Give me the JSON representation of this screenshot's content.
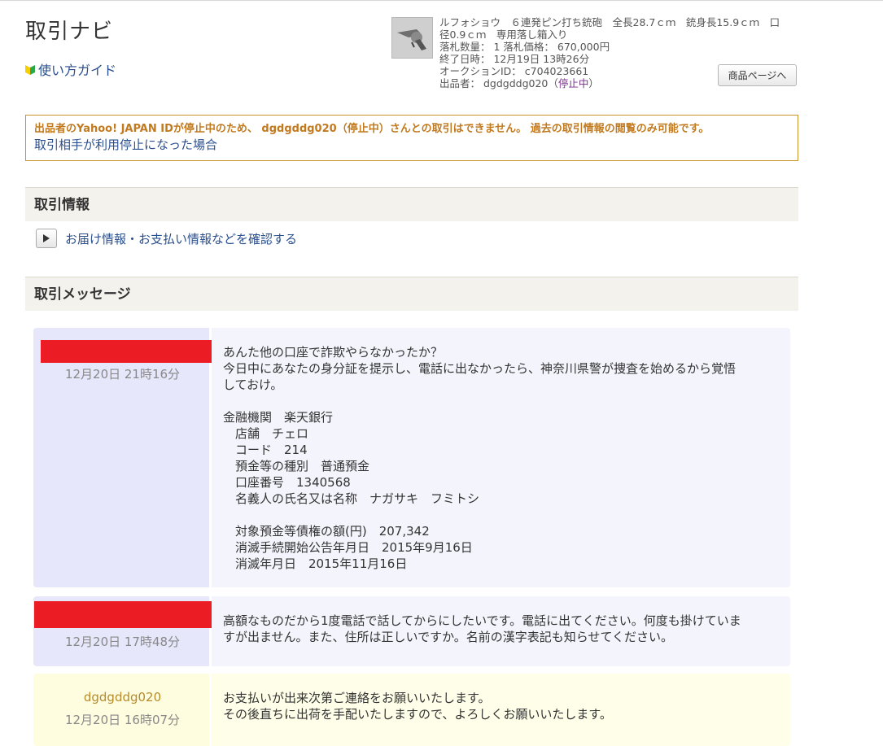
{
  "header": {
    "title": "取引ナビ",
    "guide_link": "使い方ガイド"
  },
  "item": {
    "line1": "ルフォショウ　６連発ピン打ち銃砲　全長28.7ｃｍ　銃身長15.9ｃｍ　口",
    "line2": "径0.9ｃｍ　専用落し箱入り",
    "line3": "落札数量：  1  落札価格：  670,000円",
    "line4": "終了日時：  12月19日 13時26分",
    "line5": "オークションID：  c704023661",
    "seller_prefix": "出品者：  dgdgddg020（",
    "seller_status": "停止中",
    "seller_suffix": "）",
    "page_button": "商品ページへ"
  },
  "notice": {
    "warning": "出品者のYahoo! JAPAN IDが停止中のため、 dgdgddg020（停止中）さんとの取引はできません。 過去の取引情報の閲覧のみ可能です。",
    "link": "取引相手が利用停止になった場合"
  },
  "trade_info": {
    "heading": "取引情報",
    "link": "お届け情報・お支払い情報などを確認する"
  },
  "messages": {
    "heading": "取引メッセージ",
    "items": [
      {
        "timestamp": "12月20日 21時16分",
        "text": "あんた他の口座で詐欺やらなかったか？\n今日中にあなたの身分証を提示し、電話に出なかったら、神奈川県警が捜査を始めるから覚悟\nしておけ。\n\n金融機関　楽天銀行\n　店舗　チェロ\n　コード　214\n　預金等の種別　普通預金\n　口座番号　1340568\n　名義人の氏名又は名称　ナガサキ　フミトシ\n\n　対象預金等債権の額(円)　207,342\n　消滅手続開始公告年月日　2015年9月16日\n　消滅年月日　2015年11月16日"
      },
      {
        "timestamp": "12月20日 17時48分",
        "text": "高額なものだから1度電話で話してからにしたいです。電話に出てください。何度も掛けていま\nすが出ません。また、住所は正しいですか。名前の漢字表記も知らせてください。"
      },
      {
        "sender": "dgdgddg020",
        "timestamp": "12月20日 16時07分",
        "text": "お支払いが出来次第ご連絡をお願いいたします。\nその後直ちに出荷を手配いたしますので、よろしくお願いいたします。"
      }
    ]
  },
  "colors": {
    "link": "#2a4f8f",
    "warning": "#c27a1f",
    "redaction": "#ec1c24",
    "buyer_side": "#e6e7fb",
    "seller_side": "#fffde0"
  }
}
